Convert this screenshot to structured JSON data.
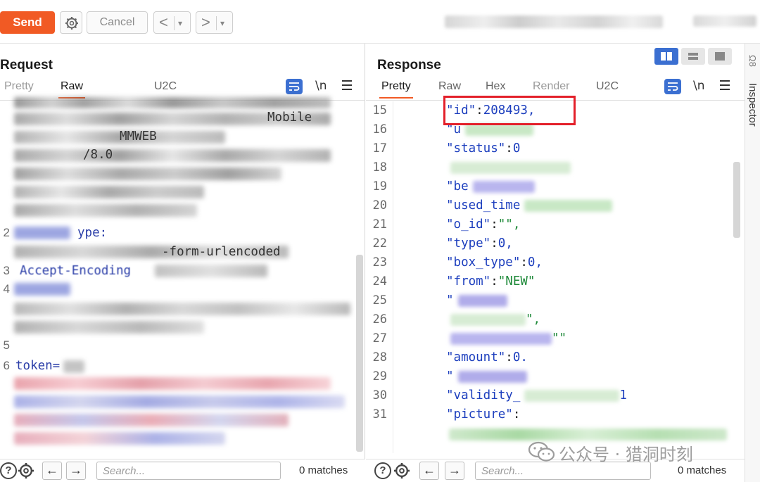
{
  "toolbar": {
    "send_label": "Send",
    "cancel_label": "Cancel",
    "back_arrow": "<",
    "forward_arrow": ">",
    "dropdown_glyph": "▾"
  },
  "request": {
    "title": "Request",
    "tabs": [
      "Pretty",
      "Raw",
      "U2C"
    ],
    "active_tab": "Raw",
    "wrap_glyph": "\\n",
    "visible_fragments": [
      {
        "text": "MMWEB",
        "row": 2
      },
      {
        "text": "/8.0",
        "row": 3
      },
      {
        "text": "Mobile",
        "row": 1
      },
      {
        "text": "ype:",
        "row": 5
      },
      {
        "text": "-form-urlencoded",
        "row": 6
      },
      {
        "text": "Accept-Encoding",
        "row": 7
      },
      {
        "text": "token=",
        "row": 13
      }
    ],
    "line_numbers": [
      "2",
      "3",
      "4",
      "5",
      "6"
    ]
  },
  "response": {
    "title": "Response",
    "tabs": [
      "Pretty",
      "Raw",
      "Hex",
      "Render",
      "U2C"
    ],
    "active_tab": "Pretty",
    "wrap_glyph": "\\n",
    "lines": [
      {
        "n": "15",
        "key": "\"id\"",
        "sep": ":",
        "val": "208493,",
        "valtype": "num",
        "redact": false
      },
      {
        "n": "16",
        "key": "\"u",
        "sep": "",
        "val": "",
        "valtype": "plain",
        "redact": true
      },
      {
        "n": "17",
        "key": "\"status\"",
        "sep": ":",
        "val": "0",
        "valtype": "num",
        "redact": false
      },
      {
        "n": "18",
        "key": "",
        "sep": "",
        "val": "",
        "valtype": "plain",
        "redact": true
      },
      {
        "n": "19",
        "key": "\"be",
        "sep": "",
        "val": "",
        "valtype": "plain",
        "redact": true
      },
      {
        "n": "20",
        "key": "\"used_time",
        "sep": "",
        "val": "",
        "valtype": "plain",
        "redact": true
      },
      {
        "n": "21",
        "key": "\"o_id\"",
        "sep": ":",
        "val": "\"\",",
        "valtype": "str",
        "redact": false
      },
      {
        "n": "22",
        "key": "\"type\"",
        "sep": ":",
        "val": "0,",
        "valtype": "num",
        "redact": false
      },
      {
        "n": "23",
        "key": "\"box_type\"",
        "sep": ":",
        "val": "0,",
        "valtype": "num",
        "redact": false
      },
      {
        "n": "24",
        "key": "\"from\"",
        "sep": ":",
        "val": "\"NEW\"",
        "valtype": "str",
        "redact": false
      },
      {
        "n": "25",
        "key": "\"",
        "sep": "",
        "val": "",
        "valtype": "plain",
        "redact": true
      },
      {
        "n": "26",
        "key": "",
        "sep": "",
        "val": "\",",
        "valtype": "str",
        "redact": true
      },
      {
        "n": "27",
        "key": "",
        "sep": "",
        "val": "\"\"",
        "valtype": "str",
        "redact": true
      },
      {
        "n": "28",
        "key": "\"amount\"",
        "sep": ":",
        "val": "0.",
        "valtype": "num",
        "redact": false
      },
      {
        "n": "29",
        "key": "\"",
        "sep": "",
        "val": "",
        "valtype": "plain",
        "redact": true
      },
      {
        "n": "30",
        "key": "\"validity_",
        "sep": "",
        "val": "1",
        "valtype": "num",
        "redact": true
      },
      {
        "n": "31",
        "key": "\"picture\"",
        "sep": ":",
        "val": "",
        "valtype": "plain",
        "redact": false
      }
    ]
  },
  "bottom_left": {
    "search_placeholder": "Search...",
    "matches": "0 matches"
  },
  "bottom_right": {
    "search_placeholder": "Search...",
    "matches": "0 matches"
  },
  "inspector": {
    "label": "Inspector",
    "top_label": "Ω8"
  },
  "watermark": {
    "text": "公众号 · 猎洞时刻"
  },
  "colors": {
    "accent": "#f15a24",
    "blue": "#3b6fd1",
    "highlight": "#e3202a",
    "json_key": "#1d3fbe",
    "json_string": "#1f8a3a"
  }
}
